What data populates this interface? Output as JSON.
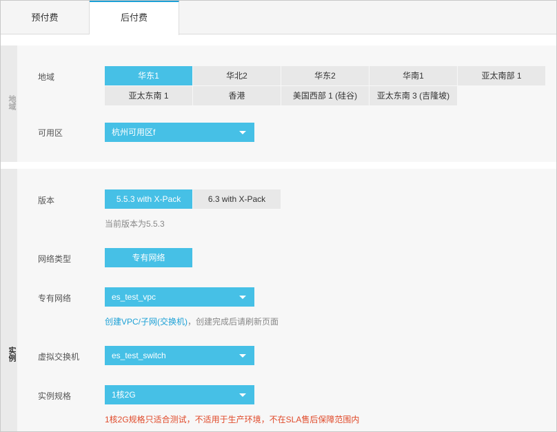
{
  "tabs": [
    "预付费",
    "后付费"
  ],
  "region_section": {
    "side_label": "地域",
    "region_label": "地域",
    "regions": [
      "华东1",
      "华北2",
      "华东2",
      "华南1",
      "亚太南部 1",
      "亚太东南 1",
      "香港",
      "美国西部 1 (硅谷)",
      "亚太东南 3 (吉隆坡)"
    ],
    "selected_region": "华东1",
    "zone_label": "可用区",
    "zone_value": "杭州可用区f"
  },
  "instance_section": {
    "side_label": "实例",
    "version_label": "版本",
    "versions": [
      "5.5.3 with X-Pack",
      "6.3 with X-Pack"
    ],
    "selected_version": "5.5.3 with X-Pack",
    "version_hint": "当前版本为5.5.3",
    "network_type_label": "网络类型",
    "network_type_value": "专有网络",
    "vpc_label": "专有网络",
    "vpc_value": "es_test_vpc",
    "vpc_link": "创建VPC/子网(交换机)",
    "vpc_hint": "，创建完成后请刷新页面",
    "vswitch_label": "虚拟交换机",
    "vswitch_value": "es_test_switch",
    "spec_label": "实例规格",
    "spec_value": "1核2G",
    "spec_warning": "1核2G规格只适合测试，不适用于生产环境，不在SLA售后保障范围内"
  },
  "colors": {
    "accent": "#46c0e6",
    "link": "#1ba0d6",
    "warning": "#e04a2a"
  }
}
